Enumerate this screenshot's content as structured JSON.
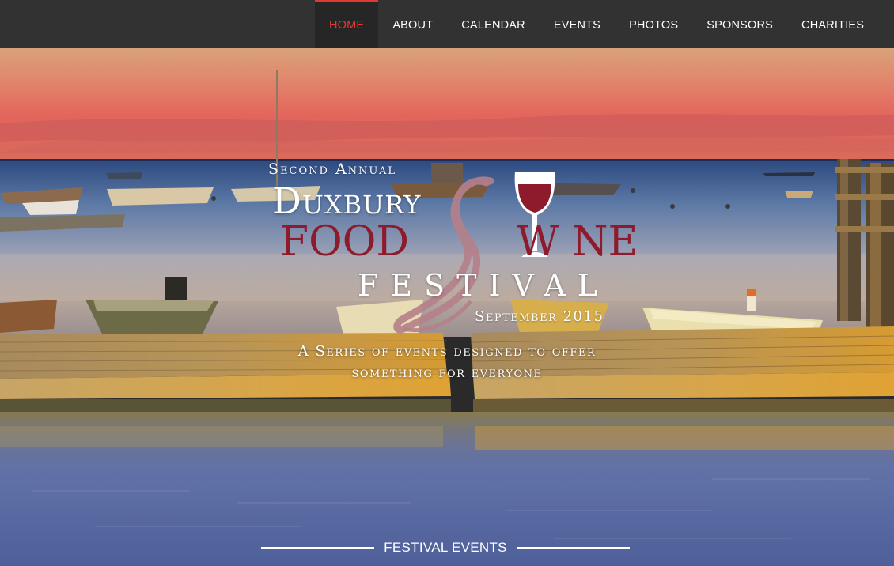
{
  "nav": {
    "items": [
      {
        "label": "HOME",
        "active": true
      },
      {
        "label": "ABOUT",
        "active": false
      },
      {
        "label": "CALENDAR",
        "active": false
      },
      {
        "label": "EVENTS",
        "active": false
      },
      {
        "label": "PHOTOS",
        "active": false
      },
      {
        "label": "SPONSORS",
        "active": false
      },
      {
        "label": "CHARITIES",
        "active": false
      }
    ]
  },
  "hero": {
    "logo": {
      "second_annual": "Second Annual",
      "duxbury": "Duxbury",
      "food": "FOOD",
      "wine": "W NE",
      "festival": "FESTIVAL",
      "date": "September 2015"
    },
    "tagline": {
      "line1": "A Series of events designed to offer",
      "line2": "something for everyone"
    }
  },
  "section": {
    "title": "FESTIVAL EVENTS"
  },
  "colors": {
    "nav_bg": "#323232",
    "nav_active": "#e23a32",
    "logo_burgundy": "#8e1b2c",
    "sunset": "#e0645f",
    "water": "#5a6fa8",
    "dock": "#c9963c"
  },
  "icons": {
    "wine_glass": "wine-glass-icon"
  }
}
